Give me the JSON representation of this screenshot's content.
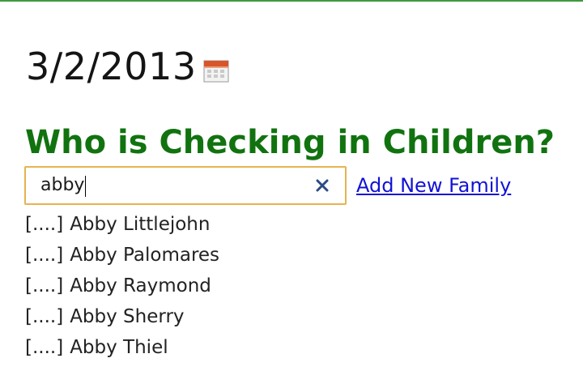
{
  "date": {
    "value": "3/2/2013",
    "icon": "calendar-icon"
  },
  "heading": "Who is Checking in Children?",
  "search": {
    "value": "abby",
    "placeholder": "",
    "clear_icon": "close-icon"
  },
  "add_family_link": "Add New Family",
  "results": [
    {
      "prefix": "[....]",
      "name": "Abby Littlejohn"
    },
    {
      "prefix": "[....]",
      "name": "Abby Palomares"
    },
    {
      "prefix": "[....]",
      "name": "Abby Raymond"
    },
    {
      "prefix": "[....]",
      "name": "Abby Sherry"
    },
    {
      "prefix": "[....]",
      "name": "Abby Thiel"
    }
  ],
  "colors": {
    "heading": "#11730f",
    "top_rule": "#3f9a3f",
    "input_focus_border": "#e6b352",
    "link": "#1212d6",
    "clear_icon": "#2b4a86"
  }
}
